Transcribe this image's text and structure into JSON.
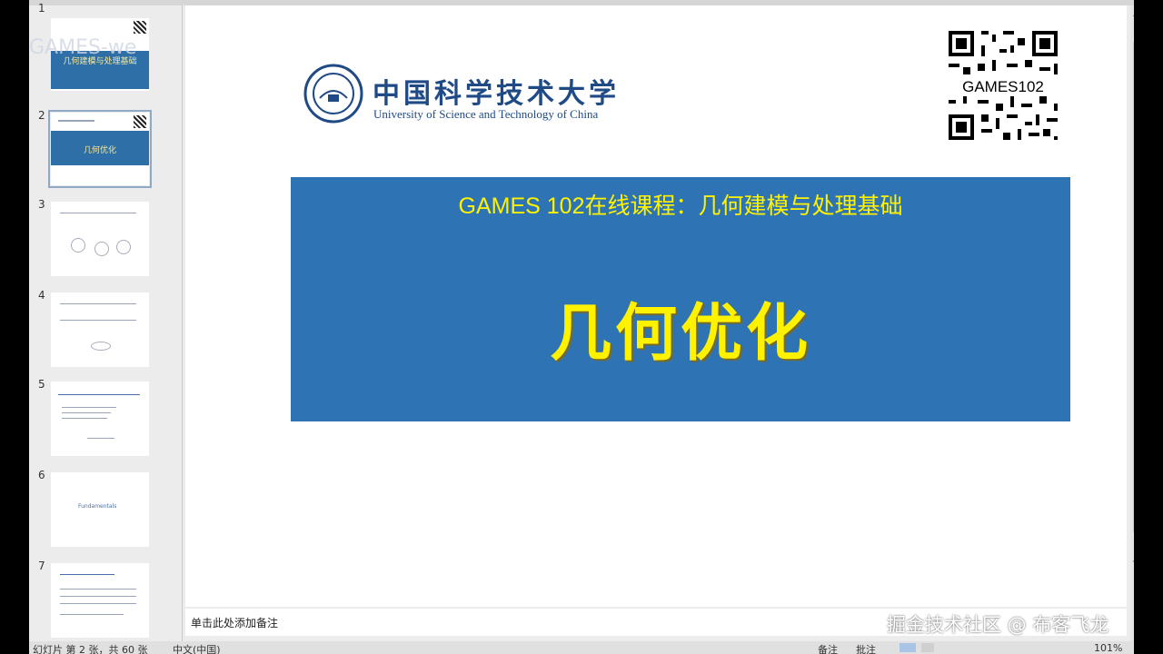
{
  "thumbnails": [
    {
      "num": "1",
      "overlay": "GAMES-we",
      "title": "几何建模与处理基础"
    },
    {
      "num": "2",
      "title": "几何优化"
    },
    {
      "num": "3"
    },
    {
      "num": "4"
    },
    {
      "num": "5"
    },
    {
      "num": "6",
      "text": "Fundamentals"
    },
    {
      "num": "7"
    }
  ],
  "slide": {
    "university_cn": "中国科学技术大学",
    "university_en": "University of Science and Technology of China",
    "qr_label": "GAMES102",
    "course_title": "GAMES 102在线课程：几何建模与处理基础",
    "main_title": "几何优化"
  },
  "notes": {
    "placeholder": "单击此处添加备注"
  },
  "watermark": "掘金技术社区 @ 布客飞龙",
  "status_bar": {
    "slide_info": "幻灯片 第 2 张，共 60 张",
    "language": "中文(中国)",
    "notes_btn": "备注",
    "comments_btn": "批注",
    "zoom": "101%"
  },
  "colors": {
    "banner": "#2e74b5",
    "title_text": "#fff200",
    "university_blue": "#1f4a86"
  }
}
